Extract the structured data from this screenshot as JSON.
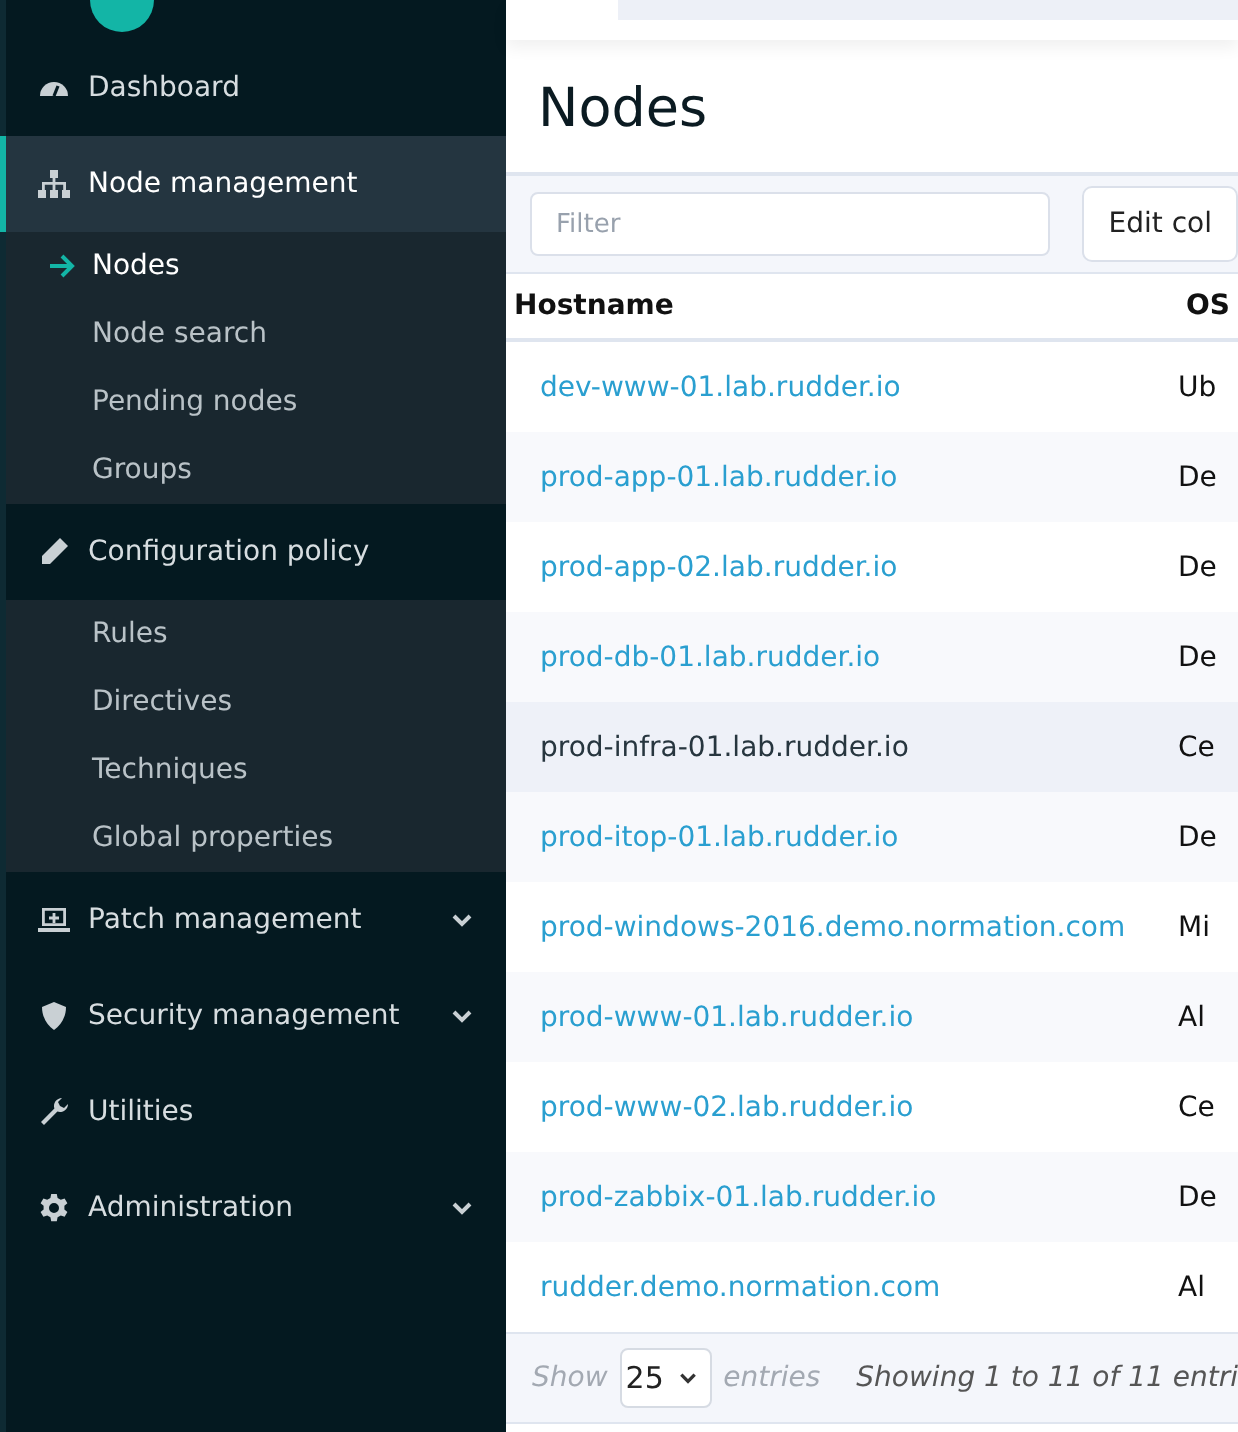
{
  "sidebar": {
    "items": [
      {
        "label": "Dashboard",
        "selected": false,
        "expandable": false
      },
      {
        "label": "Node management",
        "selected": true,
        "expandable": false,
        "children": [
          {
            "label": "Nodes",
            "selected": true
          },
          {
            "label": "Node search",
            "selected": false
          },
          {
            "label": "Pending nodes",
            "selected": false
          },
          {
            "label": "Groups",
            "selected": false
          }
        ]
      },
      {
        "label": "Configuration policy",
        "selected": false,
        "expandable": false,
        "children": [
          {
            "label": "Rules",
            "selected": false
          },
          {
            "label": "Directives",
            "selected": false
          },
          {
            "label": "Techniques",
            "selected": false
          },
          {
            "label": "Global properties",
            "selected": false
          }
        ]
      },
      {
        "label": "Patch management",
        "selected": false,
        "expandable": true
      },
      {
        "label": "Security management",
        "selected": false,
        "expandable": true
      },
      {
        "label": "Utilities",
        "selected": false,
        "expandable": false
      },
      {
        "label": "Administration",
        "selected": false,
        "expandable": true
      }
    ]
  },
  "page": {
    "title": "Nodes"
  },
  "toolbar": {
    "filter_placeholder": "Filter",
    "edit_columns_button": "Edit col"
  },
  "table": {
    "columns": [
      "Hostname",
      "OS"
    ],
    "rows": [
      {
        "hostname": "dev-www-01.lab.rudder.io",
        "os": "Ub",
        "highlighted": false
      },
      {
        "hostname": "prod-app-01.lab.rudder.io",
        "os": "De",
        "highlighted": false
      },
      {
        "hostname": "prod-app-02.lab.rudder.io",
        "os": "De",
        "highlighted": false
      },
      {
        "hostname": "prod-db-01.lab.rudder.io",
        "os": "De",
        "highlighted": false
      },
      {
        "hostname": "prod-infra-01.lab.rudder.io",
        "os": "Ce",
        "highlighted": true
      },
      {
        "hostname": "prod-itop-01.lab.rudder.io",
        "os": "De",
        "highlighted": false
      },
      {
        "hostname": "prod-windows-2016.demo.normation.com",
        "os": "Mi",
        "highlighted": false
      },
      {
        "hostname": "prod-www-01.lab.rudder.io",
        "os": "Al",
        "highlighted": false
      },
      {
        "hostname": "prod-www-02.lab.rudder.io",
        "os": "Ce",
        "highlighted": false
      },
      {
        "hostname": "prod-zabbix-01.lab.rudder.io",
        "os": "De",
        "highlighted": false
      },
      {
        "hostname": "rudder.demo.normation.com",
        "os": "Al",
        "highlighted": false
      }
    ]
  },
  "footer": {
    "show_label": "Show",
    "page_size": "25",
    "entries_label": "entries",
    "info": "Showing 1 to 11 of 11 entri"
  }
}
